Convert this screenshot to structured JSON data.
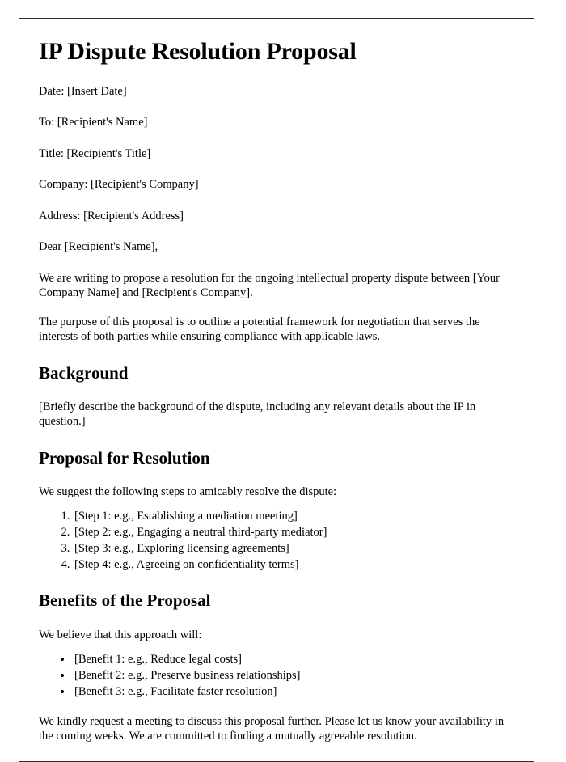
{
  "document": {
    "title": "IP Dispute Resolution Proposal",
    "header_fields": [
      "Date: [Insert Date]",
      "To: [Recipient's Name]",
      "Title: [Recipient's Title]",
      "Company: [Recipient's Company]",
      "Address: [Recipient's Address]"
    ],
    "salutation": "Dear [Recipient's Name],",
    "intro_paragraphs": [
      "We are writing to propose a resolution for the ongoing intellectual property dispute between [Your Company Name] and [Recipient's Company].",
      "The purpose of this proposal is to outline a potential framework for negotiation that serves the interests of both parties while ensuring compliance with applicable laws."
    ],
    "sections": {
      "background": {
        "heading": "Background",
        "body": "[Briefly describe the background of the dispute, including any relevant details about the IP in question.]"
      },
      "proposal": {
        "heading": "Proposal for Resolution",
        "lead_in": "We suggest the following steps to amicably resolve the dispute:",
        "steps": [
          "[Step 1: e.g., Establishing a mediation meeting]",
          "[Step 2: e.g., Engaging a neutral third-party mediator]",
          "[Step 3: e.g., Exploring licensing agreements]",
          "[Step 4: e.g., Agreeing on confidentiality terms]"
        ]
      },
      "benefits": {
        "heading": "Benefits of the Proposal",
        "lead_in": "We believe that this approach will:",
        "items": [
          "[Benefit 1: e.g., Reduce legal costs]",
          "[Benefit 2: e.g., Preserve business relationships]",
          "[Benefit 3: e.g., Facilitate faster resolution]"
        ]
      }
    },
    "closing_paragraph": "We kindly request a meeting to discuss this proposal further. Please let us know your availability in the coming weeks. We are committed to finding a mutually agreeable resolution."
  }
}
